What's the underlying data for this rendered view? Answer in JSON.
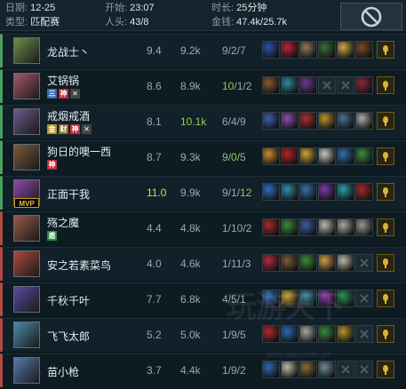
{
  "header": {
    "date_label": "日期:",
    "date_value": "12-25",
    "start_label": "开始:",
    "start_value": "23:07",
    "duration_label": "时长:",
    "duration_value": "25分钟",
    "type_label": "类型:",
    "type_value": "匹配赛",
    "kills_label": "人头:",
    "kills_value": "43/8",
    "gold_label": "金钱:",
    "gold_value": "47.4k/25.7k"
  },
  "close_icon": "prohibit-icon",
  "players": [
    {
      "name": "龙战士丶",
      "score": "9.4",
      "gold": "9.2k",
      "kda": "9/2/7",
      "team": "win",
      "mvp": false,
      "badges": [],
      "portrait_color": "#6d8f4a",
      "items": [
        "#2f4ea8",
        "#b8263a",
        "#8c7a58",
        "#3b6e3a",
        "#c9a94a",
        "#7a4b2a"
      ],
      "ward": "#d7b43c"
    },
    {
      "name": "艾锅锅",
      "score": "8.6",
      "gold": "8.9k",
      "kda_k": "10",
      "kda_rest": "/1/2",
      "team": "win",
      "mvp": false,
      "badges": [
        "三",
        "神",
        "✕"
      ],
      "portrait_color": "#a5576b",
      "items": [
        "#8b5a2b",
        "#2c8a9b",
        "#6b3b8a",
        "empty",
        "empty",
        "#8a2a3a"
      ],
      "ward": "#d7b43c"
    },
    {
      "name": "戒烟戒酒",
      "score": "8.1",
      "gold": "10.1k",
      "kda": "6/4/9",
      "team": "win",
      "mvp": false,
      "badges": [
        "金",
        "财",
        "神",
        "✕"
      ],
      "portrait_color": "#6a5b8c",
      "items": [
        "#3a5fae",
        "#8e4eb0",
        "#aa3030",
        "#b8902e",
        "#4c6e8f",
        "#a8aaa6"
      ],
      "ward": "#d7b43c"
    },
    {
      "name": "狗日的噢一西",
      "score": "8.7",
      "gold": "9.3k",
      "kda_a": "9",
      "kda_mid": "/0/",
      "kda_b": "5",
      "team": "win",
      "mvp": false,
      "badges": [
        "神"
      ],
      "portrait_color": "#7a5a3a",
      "items": [
        "#c98b2e",
        "#b02424",
        "#d1a23a",
        "#c9c7bf",
        "#2e6fae",
        "#3b8b3a"
      ],
      "ward": "#d7b43c"
    },
    {
      "name": "正面干我",
      "score": "11.0",
      "gold": "9.9k",
      "kda_a": "9/1/",
      "kda_b": "12",
      "team": "win",
      "mvp": true,
      "badges": [],
      "portrait_color": "#8a4aa8",
      "items": [
        "#2f6ec0",
        "#2d8fa8",
        "#3a6ea8",
        "#7a3aa8",
        "#2a9aaa",
        "#a02a2a"
      ],
      "ward": "#d7b43c"
    },
    {
      "name": "殇之魔",
      "score": "4.4",
      "gold": "4.8k",
      "kda": "1/10/2",
      "team": "lose",
      "mvp": false,
      "badges": [
        "盾"
      ],
      "portrait_color": "#9a5a4a",
      "items": [
        "#a82a2a",
        "#3a8a3a",
        "#3b5e9e",
        "#b8b8b0",
        "#a8a8a0",
        "#9a9a92"
      ],
      "ward": "#d7b43c"
    },
    {
      "name": "安之若素菜鸟",
      "score": "4.0",
      "gold": "4.6k",
      "kda": "1/11/3",
      "team": "lose",
      "mvp": false,
      "badges": [],
      "portrait_color": "#b04a3a",
      "items": [
        "#b02a3a",
        "#7a5a3a",
        "#3a8a3a",
        "#c9a048",
        "#b8b6ac",
        "empty"
      ],
      "ward": "#d7b43c"
    },
    {
      "name": "千秋千叶",
      "score": "7.7",
      "gold": "6.8k",
      "kda": "4/5/1",
      "team": "lose",
      "mvp": false,
      "badges": [],
      "portrait_color": "#5a4aa0",
      "items": [
        "#2a6ab0",
        "#c9a23a",
        "#3a8aa0",
        "#8a3aa8",
        "#2a8a5a",
        "empty"
      ],
      "ward": "#d7b43c"
    },
    {
      "name": "飞飞太郎",
      "score": "5.2",
      "gold": "5.0k",
      "kda": "1/9/5",
      "team": "lose",
      "mvp": false,
      "badges": [],
      "portrait_color": "#4a8aa8",
      "items": [
        "#b02a2a",
        "#2a6ab0",
        "#a8a8a0",
        "#3a8a3a",
        "#b8902e",
        "empty"
      ],
      "ward": "#d7b43c"
    },
    {
      "name": "苗小枪",
      "score": "3.7",
      "gold": "4.4k",
      "kda": "1/9/2",
      "team": "lose",
      "mvp": false,
      "badges": [],
      "portrait_color": "#5a7ab0",
      "items": [
        "#2a6ab0",
        "#b8b8b0",
        "#8a6a3a",
        "#6a8a9a",
        "empty",
        "empty"
      ],
      "ward": "#d7b43c"
    }
  ],
  "mvp_label": "MVP",
  "watermark": "玩游天下",
  "watermark_url": "www.wanyoutx.cn"
}
